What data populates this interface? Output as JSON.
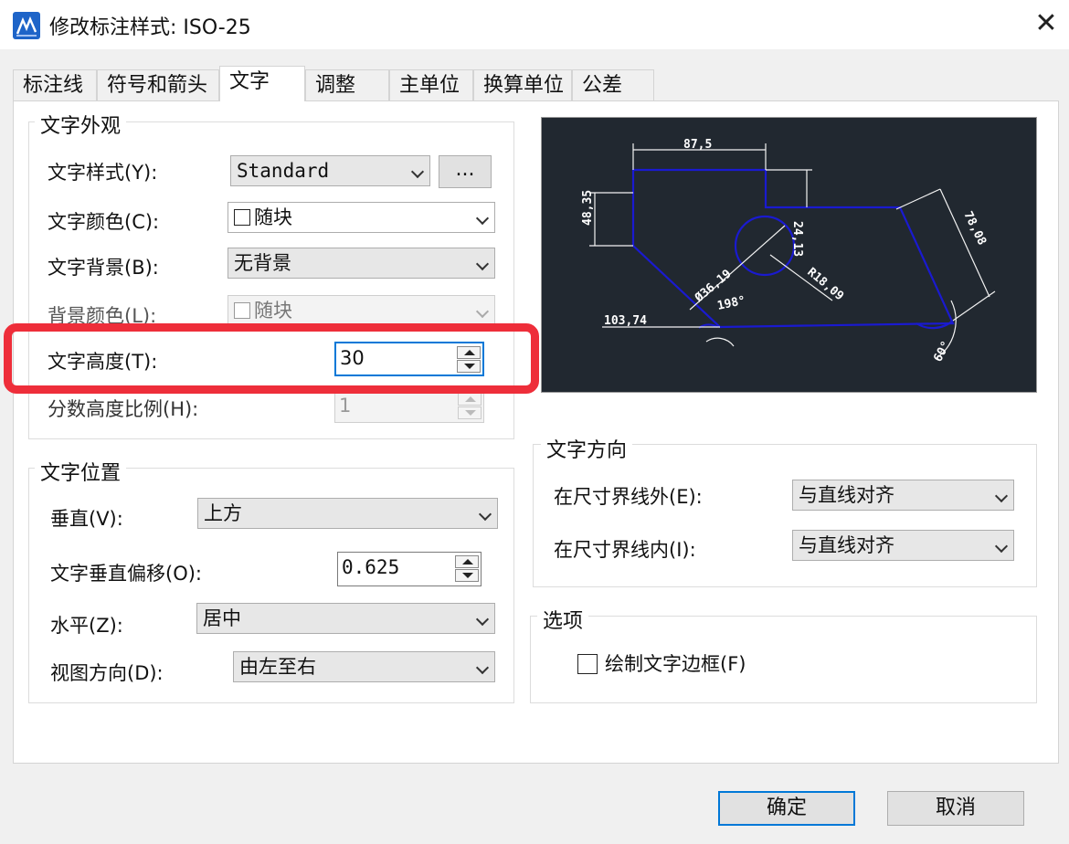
{
  "window": {
    "title": "修改标注样式: ISO-25"
  },
  "tabs": [
    {
      "label": "标注线"
    },
    {
      "label": "符号和箭头"
    },
    {
      "label": "文字"
    },
    {
      "label": "调整"
    },
    {
      "label": "主单位"
    },
    {
      "label": "换算单位"
    },
    {
      "label": "公差"
    }
  ],
  "active_tab": "文字",
  "appearance": {
    "title": "文字外观",
    "style_label": "文字样式(Y):",
    "style_value": "Standard",
    "browse_label": "...",
    "color_label": "文字颜色(C):",
    "color_value": "随块",
    "background_label": "文字背景(B):",
    "background_value": "无背景",
    "bgcolor_label": "背景颜色(L):",
    "bgcolor_value": "随块",
    "height_label": "文字高度(T):",
    "height_value": "30",
    "fraction_label": "分数高度比例(H):",
    "fraction_value": "1"
  },
  "position": {
    "title": "文字位置",
    "vertical_label": "垂直(V):",
    "vertical_value": "上方",
    "offset_label": "文字垂直偏移(O):",
    "offset_value": "0.625",
    "horizontal_label": "水平(Z):",
    "horizontal_value": "居中",
    "view_label": "视图方向(D):",
    "view_value": "由左至右"
  },
  "direction": {
    "title": "文字方向",
    "outside_label": "在尺寸界线外(E):",
    "outside_value": "与直线对齐",
    "inside_label": "在尺寸界线内(I):",
    "inside_value": "与直线对齐"
  },
  "options": {
    "title": "选项",
    "frame_label": "绘制文字边框(F)"
  },
  "preview": {
    "dim_top": "87,5",
    "dim_left": "48,35",
    "dim_inner": "24,13",
    "dim_diag": "78,08",
    "dim_dia": "Ø36,19",
    "dim_radius": "R18,09",
    "dim_angle": "198°",
    "dim_bottom": "103,74",
    "dim_angle2": "60°"
  },
  "buttons": {
    "ok": "确定",
    "cancel": "取消"
  },
  "colors": {
    "highlight": "#ee2e3a",
    "focus": "#0078d7",
    "preview_bg": "#212830",
    "preview_line": "#1010c8"
  }
}
